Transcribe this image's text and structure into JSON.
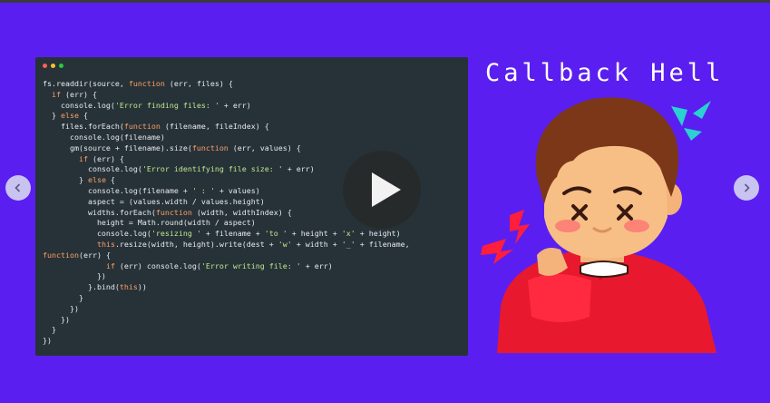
{
  "slide": {
    "title": "Callback Hell",
    "code_lines": [
      [
        [
          "",
          "fs.readdir(source, "
        ],
        [
          "k",
          "function"
        ],
        [
          "",
          " (err, files) {"
        ]
      ],
      [
        [
          "",
          "  "
        ],
        [
          "k",
          "if"
        ],
        [
          "",
          " (err) {"
        ]
      ],
      [
        [
          "",
          "    console.log("
        ],
        [
          "s",
          "'Error finding files: '"
        ],
        [
          "",
          " + err)"
        ]
      ],
      [
        [
          "",
          "  } "
        ],
        [
          "k",
          "else"
        ],
        [
          "",
          " {"
        ]
      ],
      [
        [
          "",
          "    files.forEach("
        ],
        [
          "k",
          "function"
        ],
        [
          "",
          " (filename, fileIndex) {"
        ]
      ],
      [
        [
          "",
          "      console.log(filename)"
        ]
      ],
      [
        [
          "",
          "      gm(source + filename).size("
        ],
        [
          "k",
          "function"
        ],
        [
          "",
          " (err, values) {"
        ]
      ],
      [
        [
          "",
          "        "
        ],
        [
          "k",
          "if"
        ],
        [
          "",
          " (err) {"
        ]
      ],
      [
        [
          "",
          "          console.log("
        ],
        [
          "s",
          "'Error identifying file size: '"
        ],
        [
          "",
          " + err)"
        ]
      ],
      [
        [
          "",
          "        } "
        ],
        [
          "k",
          "else"
        ],
        [
          "",
          " {"
        ]
      ],
      [
        [
          "",
          "          console.log(filename + "
        ],
        [
          "s",
          "' : '"
        ],
        [
          "",
          " + values)"
        ]
      ],
      [
        [
          "",
          "          aspect = (values.width / values.height)"
        ]
      ],
      [
        [
          "",
          "          widths.forEach("
        ],
        [
          "k",
          "function"
        ],
        [
          "",
          " (width, widthIndex) {"
        ]
      ],
      [
        [
          "",
          "            height = Math.round(width / aspect)"
        ]
      ],
      [
        [
          "",
          "            console.log("
        ],
        [
          "s",
          "'resizing '"
        ],
        [
          "",
          " + filename + "
        ],
        [
          "s",
          "'to '"
        ],
        [
          "",
          " + height + "
        ],
        [
          "s",
          "'x'"
        ],
        [
          "",
          " + height)"
        ]
      ],
      [
        [
          "",
          "            "
        ],
        [
          "k",
          "this"
        ],
        [
          "",
          ".resize(width, height).write(dest + "
        ],
        [
          "s",
          "'w'"
        ],
        [
          "",
          " + width + "
        ],
        [
          "s",
          "'_'"
        ],
        [
          "",
          " + filename,"
        ]
      ],
      [
        [
          "k",
          "function"
        ],
        [
          "",
          "(err) {"
        ]
      ],
      [
        [
          "",
          "              "
        ],
        [
          "k",
          "if"
        ],
        [
          "",
          " (err) console.log("
        ],
        [
          "s",
          "'Error writing file: '"
        ],
        [
          "",
          " + err)"
        ]
      ],
      [
        [
          "",
          "            })"
        ]
      ],
      [
        [
          "",
          "          }.bind("
        ],
        [
          "k",
          "this"
        ],
        [
          "",
          "))"
        ]
      ],
      [
        [
          "",
          "        }"
        ]
      ],
      [
        [
          "",
          "      })"
        ]
      ],
      [
        [
          "",
          "    })"
        ]
      ],
      [
        [
          "",
          "  }"
        ]
      ],
      [
        [
          "",
          "})"
        ]
      ]
    ]
  },
  "controls": {
    "play_icon": "play-icon",
    "prev_icon": "chevron-left-icon",
    "next_icon": "chevron-right-icon"
  },
  "colors": {
    "background": "#5a1ff0",
    "code_bg": "#263238",
    "keyword": "#ff9e64",
    "string": "#c3e88d"
  }
}
